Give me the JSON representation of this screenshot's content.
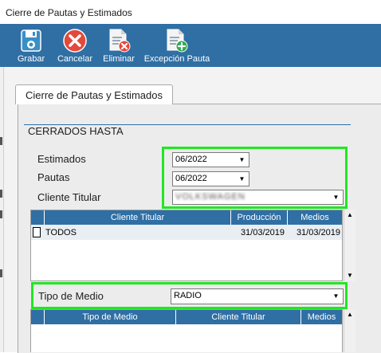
{
  "window": {
    "title": "Cierre de Pautas y Estimados"
  },
  "toolbar": {
    "grabar": "Grabar",
    "cancelar": "Cancelar",
    "eliminar": "Eliminar",
    "excepcion": "Excepción Pauta"
  },
  "tab": {
    "label": "Cierre de Pautas y Estimados"
  },
  "section": {
    "title": "CERRADOS HASTA"
  },
  "form": {
    "estimados_label": "Estimados",
    "estimados_value": "06/2022",
    "pautas_label": "Pautas",
    "pautas_value": "06/2022",
    "cliente_label": "Cliente Titular",
    "cliente_value": "VOLKSWAGEN"
  },
  "grid1": {
    "headers": [
      "Cliente Titular",
      "Producción",
      "Medios"
    ],
    "rows": [
      {
        "cliente": "TODOS",
        "produccion": "31/03/2019",
        "medios": "31/03/2019"
      }
    ]
  },
  "tipo_medio": {
    "label": "Tipo de Medio",
    "value": "RADIO"
  },
  "grid2": {
    "headers": [
      "Tipo de Medio",
      "Cliente Titular",
      "Medios"
    ]
  },
  "colors": {
    "accent": "#2f6fa4",
    "highlight": "#22e622"
  },
  "icons": [
    "save-icon",
    "cancel-icon",
    "delete-icon",
    "add-document-icon"
  ]
}
